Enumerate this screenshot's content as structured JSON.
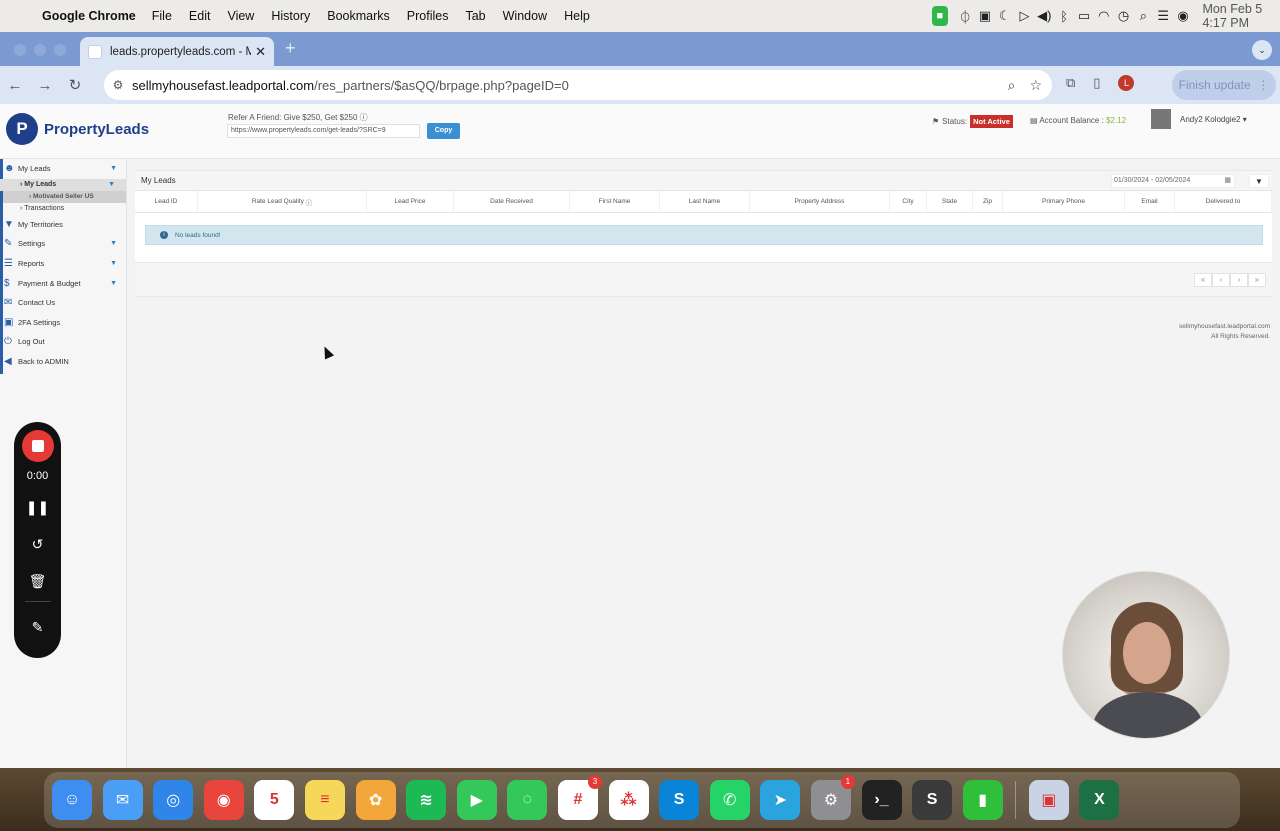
{
  "menubar": {
    "app_name": "Google Chrome",
    "items": [
      "File",
      "Edit",
      "View",
      "History",
      "Bookmarks",
      "Profiles",
      "Tab",
      "Window",
      "Help"
    ],
    "clock": "Mon Feb 5  4:17 PM"
  },
  "browser": {
    "tab_title": "leads.propertyleads.com - M",
    "url_host": "sellmyhousefast.leadportal.com",
    "url_path": "/res_partners/$asQQ/brpage.php?pageID=0",
    "profile_initial": "L",
    "finish_update": "Finish update"
  },
  "site": {
    "logo_letter": "P",
    "logo_text": "PropertyLeads",
    "refer_text": "Refer A Friend: Give $250, Get $250",
    "refer_url": "https://www.propertyleads.com/get-leads/?SRC=9",
    "copy_label": "Copy",
    "status_label": "Status:",
    "status_value": "Not Active",
    "balance_label": "Account Balance :",
    "balance_value": "$2.12",
    "user_name": "Andy2 Kolodgie2",
    "accent": "#1f3f8a",
    "status_color": "#c9302c"
  },
  "sidebar": {
    "my_leads": "My Leads",
    "my_leads_sub": "My Leads",
    "motivated": "Motivated Seller US",
    "transactions": "Transactions",
    "territories": "My Territories",
    "settings": "Settings",
    "reports": "Reports",
    "payment": "Payment & Budget",
    "contact": "Contact Us",
    "twofa": "2FA Settings",
    "logout": "Log Out",
    "back": "Back to ADMIN"
  },
  "main": {
    "panel_title": "My Leads",
    "date_range": "01/30/2024 - 02/05/2024",
    "columns": [
      "Lead ID",
      "Rate Lead Quality",
      "Lead Price",
      "Date Received",
      "First Name",
      "Last Name",
      "Property Address",
      "City",
      "State",
      "Zip",
      "Primary Phone",
      "Email",
      "Delivered to"
    ],
    "empty_message": "No leads found!",
    "footer_domain": "sellmyhousefast.leadportal.com",
    "footer_rights": "All Rights Reserved."
  },
  "recorder": {
    "timer": "0:00"
  },
  "dock": {
    "apps": [
      {
        "name": "finder",
        "color": "#3d8ef0",
        "glyph": "☺",
        "badge": ""
      },
      {
        "name": "mail",
        "color": "#4a9ef5",
        "glyph": "✉",
        "badge": ""
      },
      {
        "name": "safari",
        "color": "#2f86e8",
        "glyph": "◎",
        "badge": ""
      },
      {
        "name": "chrome",
        "color": "#e8453c",
        "glyph": "◉",
        "badge": ""
      },
      {
        "name": "calendar",
        "color": "#ffffff",
        "glyph": "5",
        "badge": ""
      },
      {
        "name": "notes",
        "color": "#f7d75a",
        "glyph": "≡",
        "badge": ""
      },
      {
        "name": "photos",
        "color": "#f3a63a",
        "glyph": "✿",
        "badge": ""
      },
      {
        "name": "spotify",
        "color": "#1db954",
        "glyph": "≋",
        "badge": ""
      },
      {
        "name": "facetime",
        "color": "#34c759",
        "glyph": "▶",
        "badge": ""
      },
      {
        "name": "messages",
        "color": "#34c759",
        "glyph": "◌",
        "badge": ""
      },
      {
        "name": "slack",
        "color": "#ffffff",
        "glyph": "#",
        "badge": "3"
      },
      {
        "name": "asana",
        "color": "#ffffff",
        "glyph": "⁂",
        "badge": ""
      },
      {
        "name": "skype",
        "color": "#0a84d6",
        "glyph": "S",
        "badge": ""
      },
      {
        "name": "whatsapp",
        "color": "#25d366",
        "glyph": "✆",
        "badge": ""
      },
      {
        "name": "telegram",
        "color": "#2aa3df",
        "glyph": "➤",
        "badge": ""
      },
      {
        "name": "system-settings",
        "color": "#8e8e93",
        "glyph": "⚙",
        "badge": "1"
      },
      {
        "name": "terminal",
        "color": "#222222",
        "glyph": "›_",
        "badge": ""
      },
      {
        "name": "sublime",
        "color": "#3a3a3a",
        "glyph": "S",
        "badge": ""
      },
      {
        "name": "numbers",
        "color": "#2fbf3a",
        "glyph": "▮",
        "badge": ""
      },
      {
        "name": "preview",
        "color": "#c8d3e6",
        "glyph": "▣",
        "badge": ""
      },
      {
        "name": "excel",
        "color": "#1d7044",
        "glyph": "X",
        "badge": ""
      }
    ]
  }
}
